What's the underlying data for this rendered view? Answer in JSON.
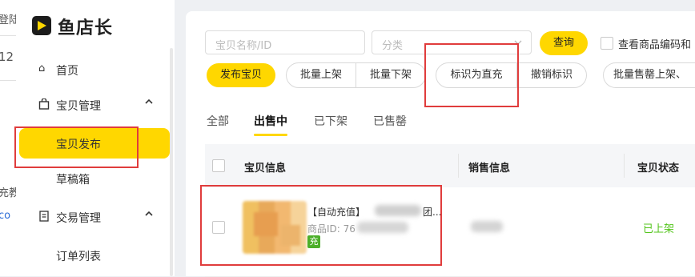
{
  "left_strip": {
    "text_1": "登陆",
    "text_2": "12",
    "text_3": "充教",
    "text_4": "co"
  },
  "sidebar": {
    "logo_text": "鱼店长",
    "items": [
      {
        "label": "首页",
        "icon": "home-icon"
      },
      {
        "label": "宝贝管理",
        "icon": "bag-icon",
        "chevron": "^"
      },
      {
        "label": "宝贝发布",
        "active": true
      },
      {
        "label": "草稿箱"
      },
      {
        "label": "交易管理",
        "icon": "list-icon",
        "chevron": "^"
      },
      {
        "label": "订单列表"
      }
    ],
    "active_color": "#ffd700"
  },
  "search": {
    "name_placeholder": "宝贝名称/ID",
    "category_placeholder": "分类",
    "query_label": "查询",
    "checkbox_label": "查看商品编码和"
  },
  "toolbar": {
    "publish_label": "发布宝贝",
    "batch_on": "批量上架",
    "batch_off": "批量下架",
    "mark_direct": "标识为直充",
    "cancel_mark": "撤销标识",
    "batch_sold": "批量售罄上架、"
  },
  "tabs": [
    {
      "label": "全部"
    },
    {
      "label": "出售中",
      "active": true
    },
    {
      "label": "已下架"
    },
    {
      "label": "已售罄"
    }
  ],
  "table": {
    "headers": [
      "宝贝信息",
      "销售信息",
      "宝贝状态"
    ],
    "rows": [
      {
        "title": "【自动充值】",
        "title_tail": "团...",
        "id_label": "商品ID: 76",
        "badge": "充",
        "status": "已上架"
      }
    ]
  },
  "colors": {
    "accent": "#ffd700",
    "highlight": "#e03c3c",
    "status_green": "#52c41a",
    "badge_green": "#4caf2a"
  }
}
